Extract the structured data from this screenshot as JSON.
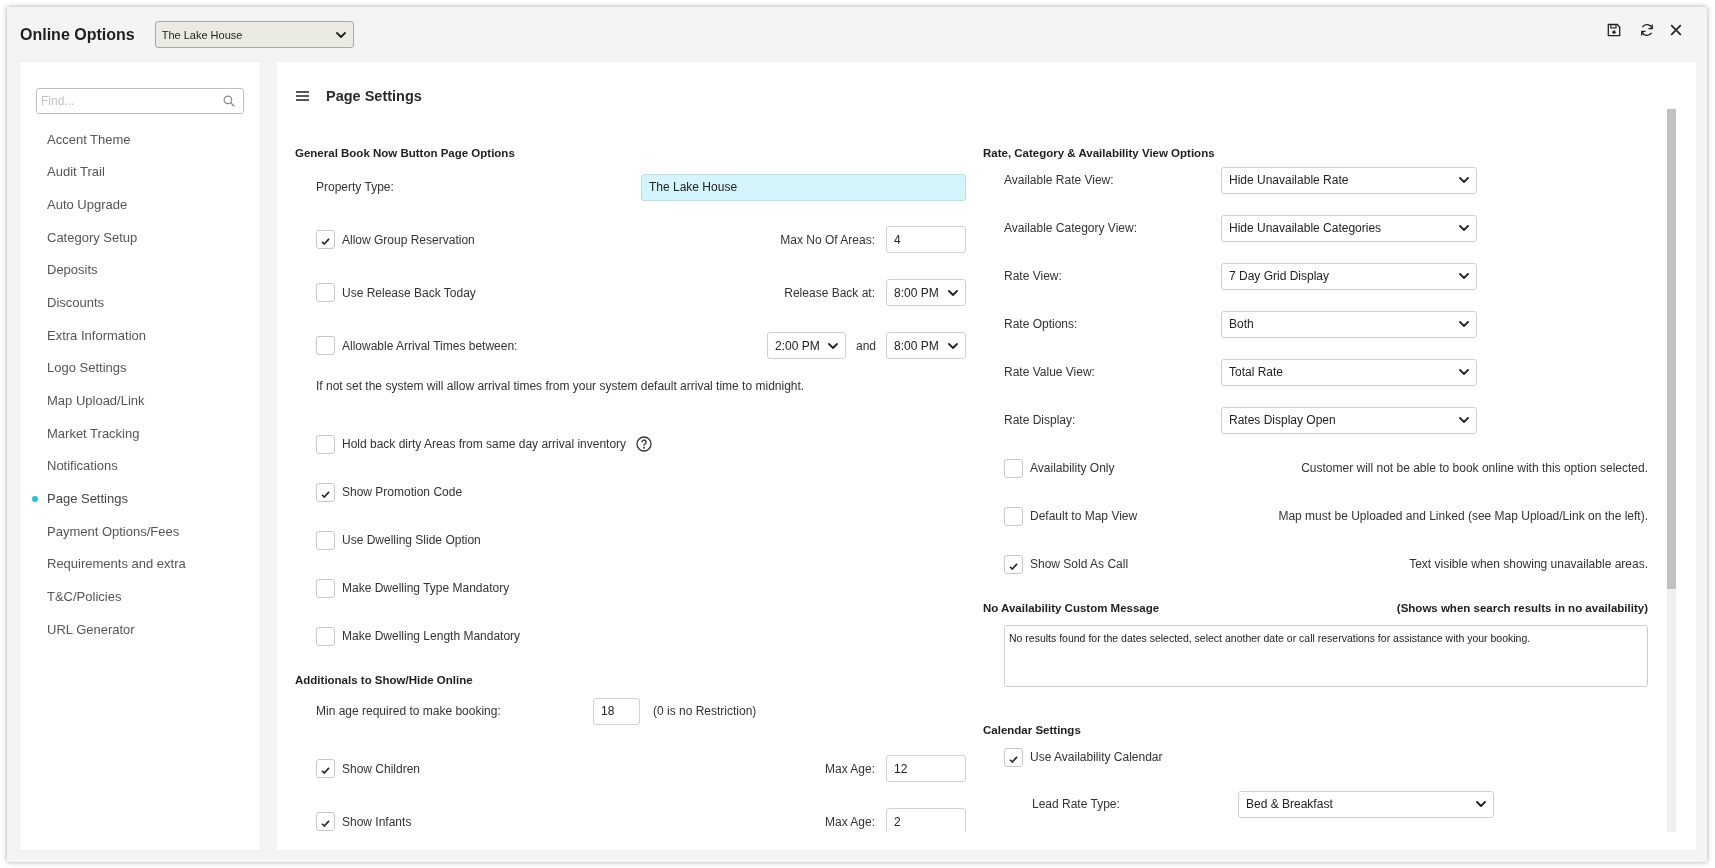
{
  "window": {
    "title": "Online Options",
    "property": "The Lake House"
  },
  "sidebar": {
    "search": {
      "placeholder": "Find..."
    },
    "items": [
      {
        "label": "Accent Theme",
        "selected": false
      },
      {
        "label": "Audit Trail",
        "selected": false
      },
      {
        "label": "Auto Upgrade",
        "selected": false
      },
      {
        "label": "Category Setup",
        "selected": false
      },
      {
        "label": "Deposits",
        "selected": false
      },
      {
        "label": "Discounts",
        "selected": false
      },
      {
        "label": "Extra Information",
        "selected": false
      },
      {
        "label": "Logo Settings",
        "selected": false
      },
      {
        "label": "Map Upload/Link",
        "selected": false
      },
      {
        "label": "Market Tracking",
        "selected": false
      },
      {
        "label": "Notifications",
        "selected": false
      },
      {
        "label": "Page Settings",
        "selected": true
      },
      {
        "label": "Payment Options/Fees",
        "selected": false
      },
      {
        "label": "Requirements and extra",
        "selected": false
      },
      {
        "label": "T&C/Policies",
        "selected": false
      },
      {
        "label": "URL Generator",
        "selected": false
      }
    ]
  },
  "page": {
    "title": "Page Settings"
  },
  "columns": [
    {
      "sections": [
        {
          "heading": "General Book Now Button Page Options",
          "rows": [
            {
              "kind": "text_field",
              "label": "Property Type:",
              "value": "The Lake House",
              "highlighted": true
            },
            {
              "kind": "checkbox",
              "label": "Allow Group Reservation",
              "checked": true,
              "side_label": "Max No Of Areas:",
              "side_field": {
                "kind": "input",
                "value": "4"
              }
            },
            {
              "kind": "checkbox",
              "label": "Use Release Back Today",
              "checked": false,
              "side_label": "Release Back at:",
              "side_field": {
                "kind": "select",
                "value": "8:00 PM"
              }
            },
            {
              "kind": "checkbox",
              "label": "Allowable Arrival Times between:",
              "checked": false,
              "range": {
                "from": "2:00 PM",
                "joiner": "and",
                "to": "8:00 PM"
              }
            },
            {
              "kind": "note",
              "text": "If not set the system will allow arrival times from your system default arrival time to midnight."
            },
            {
              "kind": "checkbox",
              "label": "Hold back dirty Areas from same day arrival inventory",
              "checked": false,
              "help": true
            },
            {
              "kind": "checkbox",
              "label": "Show Promotion Code",
              "checked": true
            },
            {
              "kind": "checkbox",
              "label": "Use Dwelling Slide Option",
              "checked": false
            },
            {
              "kind": "checkbox",
              "label": "Make Dwelling Type Mandatory",
              "checked": false
            },
            {
              "kind": "checkbox",
              "label": "Make Dwelling Length Mandatory",
              "checked": false
            }
          ]
        },
        {
          "heading": "Additionals to Show/Hide Online",
          "rows": [
            {
              "kind": "number_field",
              "label": "Min age required to make booking:",
              "value": "18",
              "hint": "(0 is no Restriction)"
            },
            {
              "kind": "checkbox",
              "label": "Show Children",
              "checked": true,
              "side_label": "Max Age:",
              "side_field": {
                "kind": "input",
                "value": "12"
              }
            },
            {
              "kind": "checkbox",
              "label": "Show Infants",
              "checked": true,
              "side_label": "Max Age:",
              "side_field": {
                "kind": "input",
                "value": "2"
              }
            }
          ]
        }
      ]
    },
    {
      "sections": [
        {
          "heading": "Rate, Category & Availability View Options",
          "rows": [
            {
              "kind": "select",
              "label": "Available Rate View:",
              "value": "Hide Unavailable Rate"
            },
            {
              "kind": "select",
              "label": "Available Category View:",
              "value": "Hide Unavailable Categories"
            },
            {
              "kind": "select",
              "label": "Rate View:",
              "value": "7 Day Grid Display"
            },
            {
              "kind": "select",
              "label": "Rate Options:",
              "value": "Both"
            },
            {
              "kind": "select",
              "label": "Rate Value View:",
              "value": "Total Rate"
            },
            {
              "kind": "select",
              "label": "Rate Display:",
              "value": "Rates Display Open"
            },
            {
              "kind": "checkbox",
              "label": "Availability Only",
              "checked": false,
              "note": "Customer will not be able to book online with this option selected."
            },
            {
              "kind": "checkbox",
              "label": "Default to Map View",
              "checked": false,
              "note": "Map must be Uploaded and Linked (see Map Upload/Link on the left)."
            },
            {
              "kind": "checkbox",
              "label": "Show Sold As Call",
              "checked": true,
              "note": "Text visible when showing unavailable areas."
            }
          ]
        },
        {
          "heading": "No Availability Custom Message",
          "heading_note": "(Shows when search results in no availability)",
          "rows": [
            {
              "kind": "textarea",
              "value": "No results found for the dates selected, select another date or call reservations for assistance with your booking."
            }
          ]
        },
        {
          "heading": "Calendar Settings",
          "rows": [
            {
              "kind": "checkbox",
              "label": "Use Availability Calendar",
              "checked": true,
              "children": [
                {
                  "kind": "select",
                  "label": "Lead Rate Type:",
                  "value": "Bed & Breakfast"
                }
              ]
            }
          ]
        }
      ]
    }
  ]
}
